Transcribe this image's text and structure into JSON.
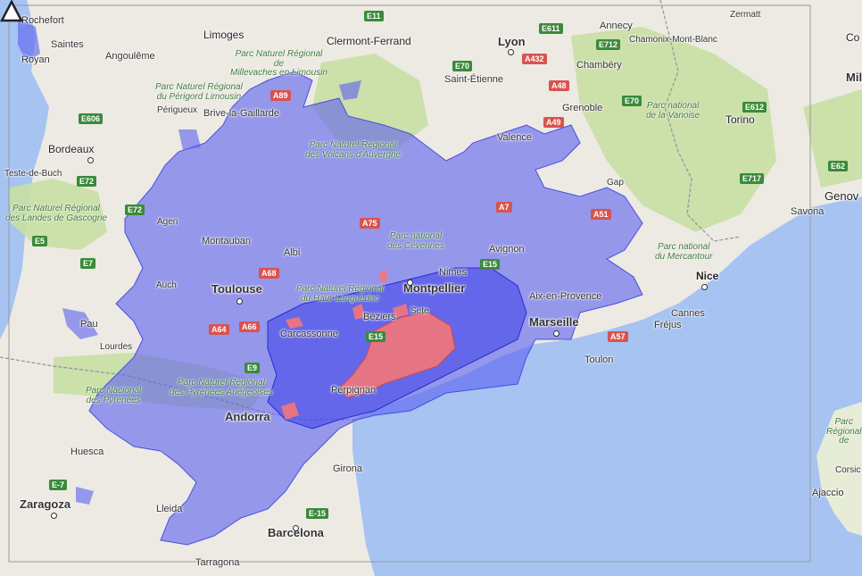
{
  "cities": [
    {
      "name": "Rochefort",
      "cls": "small"
    },
    {
      "name": "Saintes",
      "cls": "small"
    },
    {
      "name": "Royan",
      "cls": "small"
    },
    {
      "name": "Angoulême",
      "cls": "small"
    },
    {
      "name": "Limoges",
      "cls": "med"
    },
    {
      "name": "Clermont-Ferrand",
      "cls": "med"
    },
    {
      "name": "Lyon",
      "cls": "big"
    },
    {
      "name": "Annecy",
      "cls": "small"
    },
    {
      "name": "Zermatt",
      "cls": "small"
    },
    {
      "name": "Chamonix-Mont-Blanc",
      "cls": "small"
    },
    {
      "name": "Chambéry",
      "cls": "small"
    },
    {
      "name": "Saint-Étienne",
      "cls": "small"
    },
    {
      "name": "Grenoble",
      "cls": "small"
    },
    {
      "name": "Périgueux",
      "cls": "small"
    },
    {
      "name": "Brive-la-Gaillarde",
      "cls": "small"
    },
    {
      "name": "Bordeaux",
      "cls": "med"
    },
    {
      "name": "Valence",
      "cls": "small"
    },
    {
      "name": "Torino",
      "cls": "med"
    },
    {
      "name": "Teste-de-Buch",
      "cls": "small"
    },
    {
      "name": "Gap",
      "cls": "small"
    },
    {
      "name": "Genov",
      "cls": "med"
    },
    {
      "name": "Savona",
      "cls": "small"
    },
    {
      "name": "Agen",
      "cls": "small"
    },
    {
      "name": "Montauban",
      "cls": "small"
    },
    {
      "name": "Albi",
      "cls": "small"
    },
    {
      "name": "Avignon",
      "cls": "small"
    },
    {
      "name": "Nimes",
      "cls": "small"
    },
    {
      "name": "Nice",
      "cls": "med"
    },
    {
      "name": "Auch",
      "cls": "small"
    },
    {
      "name": "Toulouse",
      "cls": "big"
    },
    {
      "name": "Montpellier",
      "cls": "big"
    },
    {
      "name": "Aix-en-Provence",
      "cls": "small"
    },
    {
      "name": "Cannes",
      "cls": "small"
    },
    {
      "name": "Pau",
      "cls": "small"
    },
    {
      "name": "Béziers",
      "cls": "small"
    },
    {
      "name": "Sete",
      "cls": "small"
    },
    {
      "name": "Marseille",
      "cls": "big"
    },
    {
      "name": "Fréjus",
      "cls": "small"
    },
    {
      "name": "Lourdes",
      "cls": "small"
    },
    {
      "name": "Carcassonne",
      "cls": "small"
    },
    {
      "name": "Toulon",
      "cls": "small"
    },
    {
      "name": "Perpignan",
      "cls": "small"
    },
    {
      "name": "Andorra",
      "cls": "big"
    },
    {
      "name": "Huesca",
      "cls": "small"
    },
    {
      "name": "Girona",
      "cls": "small"
    },
    {
      "name": "Zaragoza",
      "cls": "big"
    },
    {
      "name": "Lleida",
      "cls": "small"
    },
    {
      "name": "Ajaccio",
      "cls": "small"
    },
    {
      "name": "Barcelona",
      "cls": "big"
    },
    {
      "name": "Tarragona",
      "cls": "small"
    },
    {
      "name": "Corsic",
      "cls": "small"
    },
    {
      "name": "Mil",
      "cls": "big"
    },
    {
      "name": "Co",
      "cls": "med"
    }
  ],
  "parks": [
    {
      "name": "Parc Naturel Régional\nde\nMillevaches en Limousin"
    },
    {
      "name": "Parc Naturel Régional\ndu Périgord Limousin"
    },
    {
      "name": "Parc Naturel Régional\ndes Volcans d'Auvergne"
    },
    {
      "name": "Parc national\nde la Vanoise"
    },
    {
      "name": "Parc Naturel Régional\ndes Landes de Gascogne"
    },
    {
      "name": "Parc national\ndes Cévennes"
    },
    {
      "name": "Parc national\ndu Mercantour"
    },
    {
      "name": "Parc Naturel Régional\ndu Haut-Languedoc"
    },
    {
      "name": "Parc Naturel Régional\ndes Pyrénées Ariégeoises"
    },
    {
      "name": "Parc Nacional\ndes Pyrénées"
    },
    {
      "name": "Parc\nRégional\nde"
    }
  ],
  "roads": [
    {
      "label": "E11",
      "type": "e"
    },
    {
      "label": "E611",
      "type": "e"
    },
    {
      "label": "E712",
      "type": "e"
    },
    {
      "label": "E70",
      "type": "e"
    },
    {
      "label": "A432",
      "type": "a"
    },
    {
      "label": "A89",
      "type": "a"
    },
    {
      "label": "A48",
      "type": "a"
    },
    {
      "label": "E70",
      "type": "e"
    },
    {
      "label": "E612",
      "type": "e"
    },
    {
      "label": "E606",
      "type": "e"
    },
    {
      "label": "A49",
      "type": "a"
    },
    {
      "label": "E62",
      "type": "e"
    },
    {
      "label": "E72",
      "type": "e"
    },
    {
      "label": "E717",
      "type": "e"
    },
    {
      "label": "E72",
      "type": "e"
    },
    {
      "label": "A75",
      "type": "a"
    },
    {
      "label": "A7",
      "type": "a"
    },
    {
      "label": "A51",
      "type": "a"
    },
    {
      "label": "E5",
      "type": "e"
    },
    {
      "label": "E7",
      "type": "e"
    },
    {
      "label": "A68",
      "type": "a"
    },
    {
      "label": "E15",
      "type": "e"
    },
    {
      "label": "A64",
      "type": "a"
    },
    {
      "label": "A66",
      "type": "a"
    },
    {
      "label": "A57",
      "type": "a"
    },
    {
      "label": "E9",
      "type": "e"
    },
    {
      "label": "E15",
      "type": "e"
    },
    {
      "label": "E-7",
      "type": "e"
    },
    {
      "label": "E-15",
      "type": "e"
    }
  ],
  "marker": {
    "symbol": "△"
  },
  "colors": {
    "land": "#eceae2",
    "sea": "#a6c3f2",
    "forest": "#c9dfa4",
    "coverage_blue": "#5b5ff0",
    "coverage_red": "#f3767a"
  }
}
